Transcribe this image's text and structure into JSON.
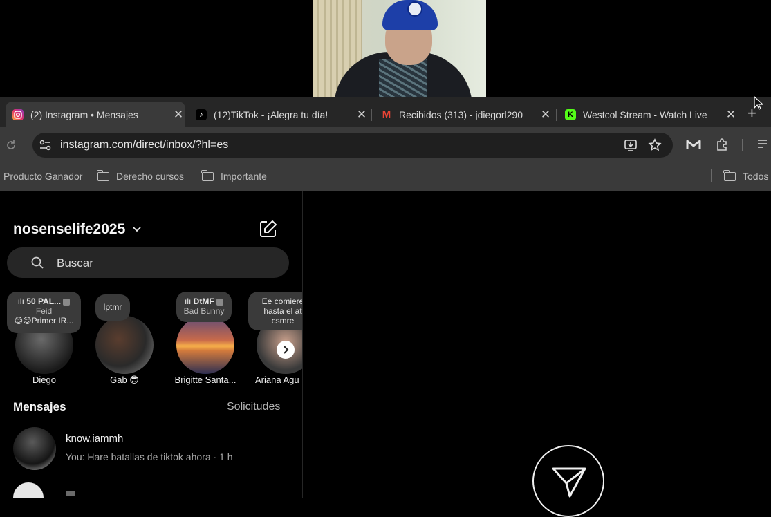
{
  "browser": {
    "tabs": [
      {
        "title": "(2) Instagram • Mensajes",
        "icon": "instagram-icon",
        "active": true
      },
      {
        "title": "(12)TikTok - ¡Alegra tu día!",
        "icon": "tiktok-icon",
        "active": false
      },
      {
        "title": "Recibidos (313) - jdiegorl290",
        "icon": "gmail-icon",
        "active": false
      },
      {
        "title": "Westcol Stream - Watch Live",
        "icon": "kick-icon",
        "active": false
      }
    ],
    "new_tab_symbol": "+",
    "close_symbol": "✕",
    "url": "instagram.com/direct/inbox/?hl=es",
    "bookmarks": [
      {
        "label": "Producto Ganador",
        "type": "link"
      },
      {
        "label": "Derecho cursos",
        "type": "folder"
      },
      {
        "label": "Importante",
        "type": "folder"
      }
    ],
    "all_bookmarks": "Todos"
  },
  "instagram": {
    "username": "nosenselife2025",
    "search_placeholder": "Buscar",
    "stories": [
      {
        "name": "Diego",
        "note_title": "50 PAL...",
        "note_artist": "Feid",
        "note_line": "😊😊Primer IR..."
      },
      {
        "name": "Gab 😎",
        "note_text": "lptmr"
      },
      {
        "name": "Brigitte Santa...",
        "note_title": "DtMF",
        "note_artist": "Bad Bunny"
      },
      {
        "name": "Ariana Agu",
        "note_text": "Ee comiere hasta el at csmre"
      }
    ],
    "messages_header": "Mensajes",
    "requests_label": "Solicitudes",
    "conversations": [
      {
        "name": "know.iammh",
        "preview": "You: Hare batallas de tiktok ahora · 1 h"
      }
    ]
  }
}
